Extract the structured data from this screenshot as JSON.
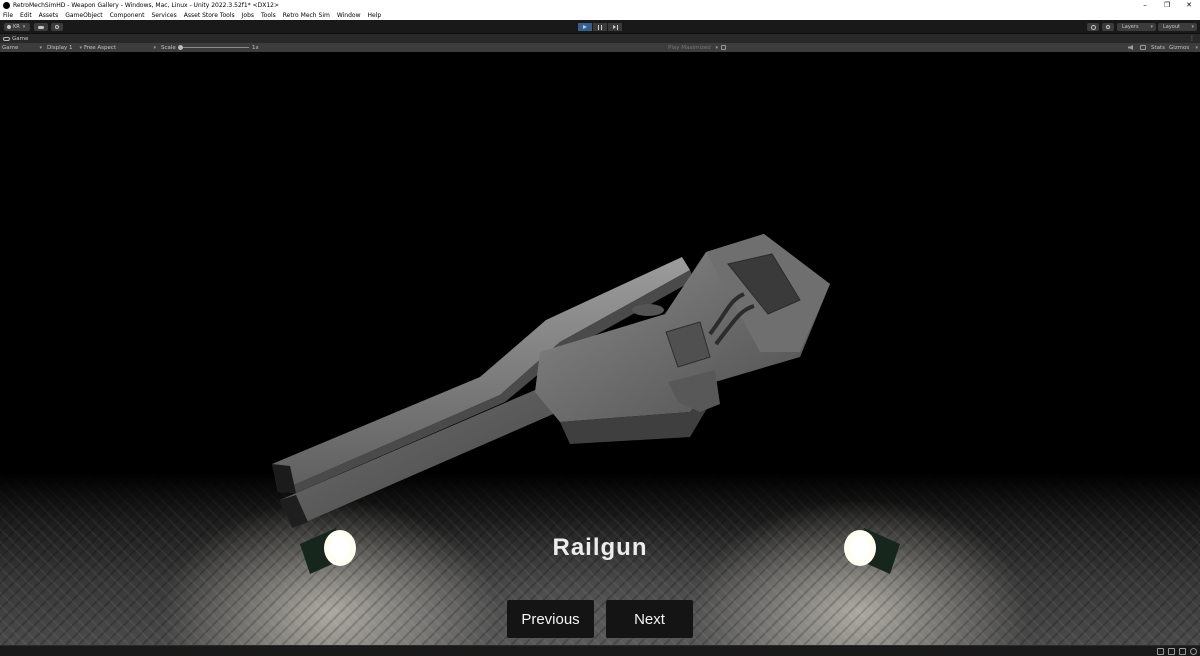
{
  "window": {
    "title": "RetroMechSimHD - Weapon Gallery - Windows, Mac, Linux - Unity 2022.3.52f1* <DX12>",
    "controls": [
      "–",
      "❐",
      "✕"
    ]
  },
  "menu": [
    "File",
    "Edit",
    "Assets",
    "GameObject",
    "Component",
    "Services",
    "Asset Store Tools",
    "Jobs",
    "Tools",
    "Retro Mech Sim",
    "Window",
    "Help"
  ],
  "toolbar": {
    "account_label": "KR",
    "layers_label": "Layers",
    "layout_label": "Layout",
    "play_active": true
  },
  "game_tab": {
    "label": "Game",
    "menu_glyph": "⋮"
  },
  "game_view_bar": {
    "view_select": "Game",
    "display_select": "Display 1",
    "aspect_select": "Free Aspect",
    "scale_label": "Scale",
    "scale_value": "1x",
    "play_mode_select": "Play Maximized",
    "stats_label": "Stats",
    "gizmos_label": "Gizmos"
  },
  "scene": {
    "weapon_name": "Railgun",
    "previous_label": "Previous",
    "next_label": "Next"
  },
  "colors": {
    "play_active": "#3a5f86",
    "background": "#000000",
    "button_bg": "#141414"
  }
}
